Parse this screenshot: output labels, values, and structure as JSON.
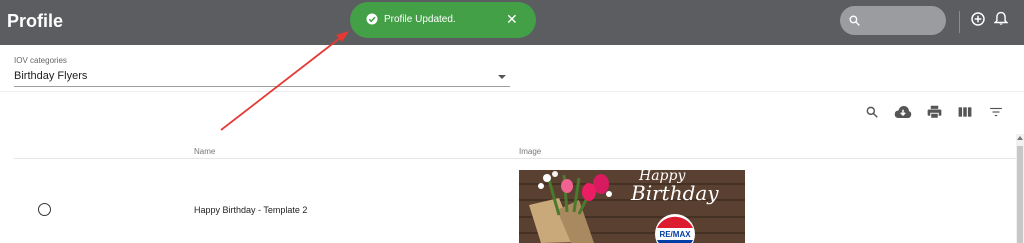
{
  "header": {
    "title": "Profile"
  },
  "toast": {
    "message": "Profile Updated.",
    "close": "✕"
  },
  "filter": {
    "label": "IOV categories",
    "value": "Birthday Flyers"
  },
  "table": {
    "columns": {
      "name": "Name",
      "image": "Image"
    },
    "rows": [
      {
        "name": "Happy Birthday - Template 2"
      }
    ]
  },
  "thumbnail": {
    "script": "Happy",
    "script2": "Birthday",
    "brand": "RE/MAX"
  },
  "colors": {
    "header_bg": "#5b5d61",
    "toast_bg": "#43a047",
    "annotation_arrow": "#e53935",
    "brand_red": "#dc1c2e",
    "brand_blue": "#003da5"
  },
  "icons": [
    "search-icon",
    "add-circle-icon",
    "bell-icon",
    "check-circle-icon",
    "close-icon",
    "cloud-download-icon",
    "print-icon",
    "columns-icon",
    "filter-icon"
  ]
}
